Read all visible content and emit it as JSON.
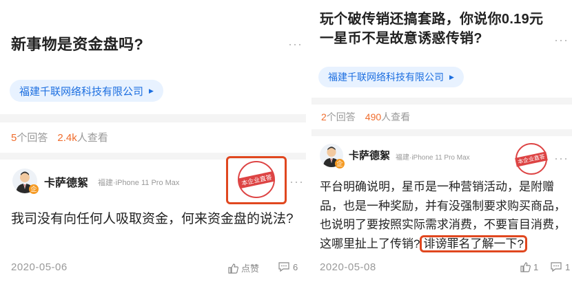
{
  "left": {
    "title": "新事物是资金盘吗?",
    "more": "···",
    "company_tag": "福建千联网络科技有限公司",
    "answers_count": "5",
    "answers_label": "个回答",
    "views_count": "2.4k",
    "views_label": "人查看",
    "user_name": "卡萨德絮",
    "device": "福建·iPhone 11 Pro Max",
    "badge": "企",
    "stamp_text": "本企业直答",
    "answer_text": "我司没有向任何人吸取资金，何来资金盘的说法?",
    "date": "2020-05-06",
    "like_label": "点赞",
    "comment_count": "6"
  },
  "right": {
    "title": "玩个破传销还搞套路，你说你0.19元一星币不是故意诱惑传销?",
    "more": "···",
    "company_tag": "福建千联网络科技有限公司",
    "answers_count": "2",
    "answers_label": "个回答",
    "views_count": "490",
    "views_label": "人查看",
    "user_name": "卡萨德絮",
    "device": "福建·iPhone 11 Pro Max",
    "badge": "企",
    "stamp_text": "本企业直答",
    "answer_text": "平台明确说明，星币是一种营销活动，是附赠品，也是一种奖励，并有没强制要求购买商品，也说明了要按照实际需求消费，不要盲目消费，这哪里扯上了传销?",
    "answer_highlight": "诽谤罪名了解一下?",
    "date": "2020-05-08",
    "like_count": "1",
    "comment_count": "1"
  }
}
